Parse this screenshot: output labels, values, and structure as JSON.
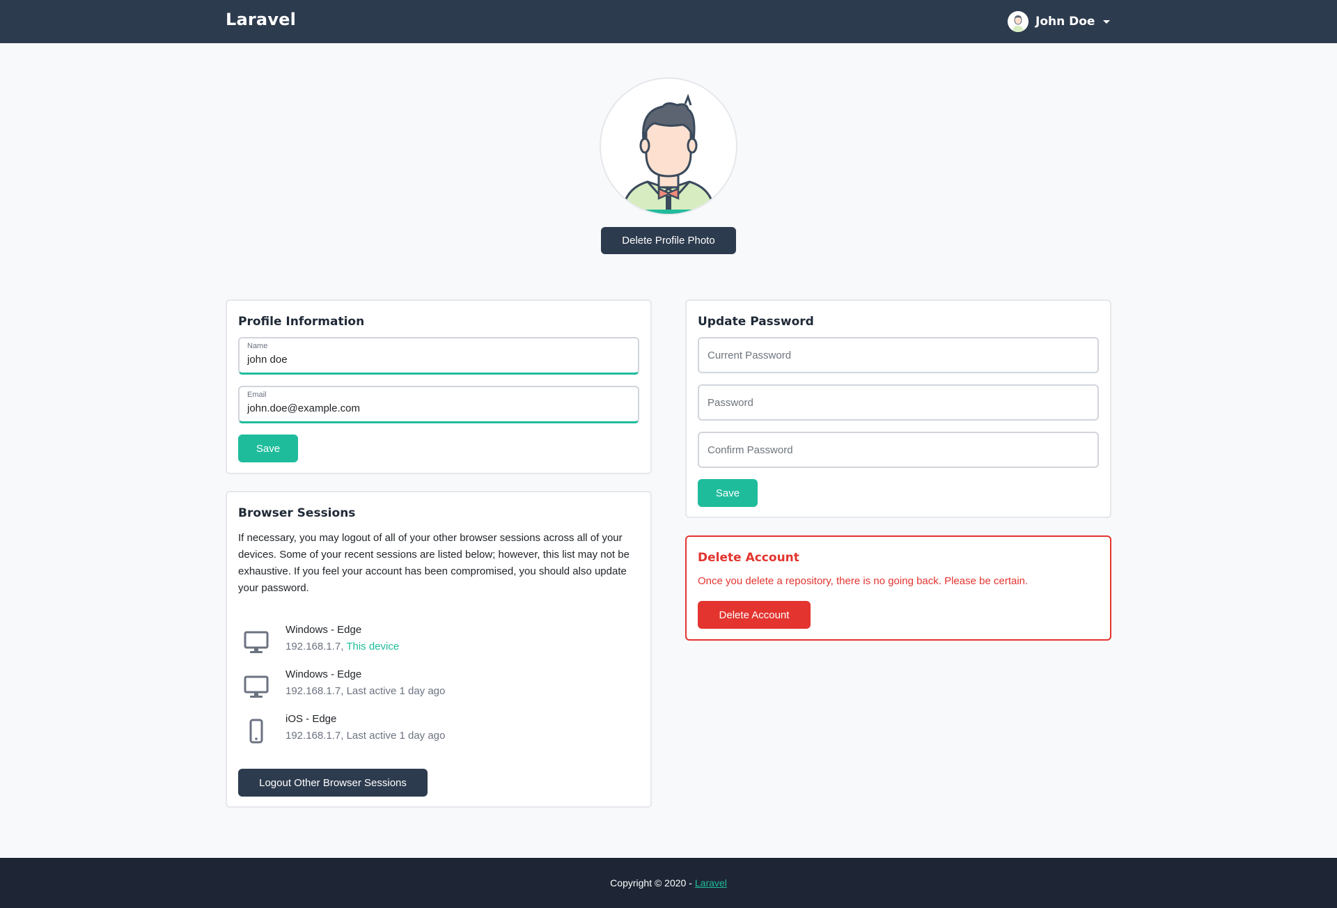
{
  "navbar": {
    "brand": "Laravel",
    "user_name": "John Doe"
  },
  "profile_photo": {
    "delete_label": "Delete Profile Photo"
  },
  "profile_info": {
    "title": "Profile Information",
    "name_label": "Name",
    "name_value": "john doe",
    "email_label": "Email",
    "email_value": "john.doe@example.com",
    "save_label": "Save"
  },
  "sessions": {
    "title": "Browser Sessions",
    "description": "If necessary, you may logout of all of your other browser sessions across all of your devices. Some of your recent sessions are listed below; however, this list may not be exhaustive. If you feel your account has been compromised, you should also update your password.",
    "items": [
      {
        "device": "Windows - Edge",
        "ip": "192.168.1.7,",
        "status": "This device",
        "icon": "desktop-icon"
      },
      {
        "device": "Windows - Edge",
        "ip": "192.168.1.7,",
        "status": "Last active 1 day ago",
        "icon": "desktop-icon"
      },
      {
        "device": "iOS - Edge",
        "ip": "192.168.1.7,",
        "status": "Last active 1 day ago",
        "icon": "mobile-icon"
      }
    ],
    "logout_label": "Logout Other Browser Sessions"
  },
  "password": {
    "title": "Update Password",
    "current_placeholder": "Current Password",
    "new_placeholder": "Password",
    "confirm_placeholder": "Confirm Password",
    "save_label": "Save"
  },
  "delete_account": {
    "title": "Delete Account",
    "warning": "Once you delete a repository, there is no going back. Please be certain.",
    "button_label": "Delete Account"
  },
  "footer": {
    "copyright": "Copyright © 2020 -",
    "link": "Laravel"
  },
  "colors": {
    "navbar": "#2d3b4e",
    "accent": "#1fbc9c",
    "danger": "#e3342f",
    "footer": "#1e2635"
  }
}
